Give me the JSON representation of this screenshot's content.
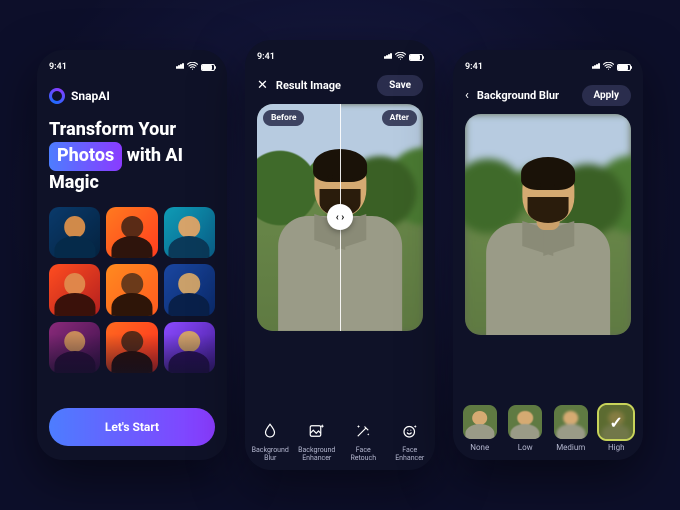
{
  "status": {
    "time": "9:41"
  },
  "screen1": {
    "brand": "SnapAI",
    "hero_line1": "Transform Your",
    "hero_highlight": "Photos",
    "hero_line2_suffix": "with AI",
    "hero_line3": "Magic",
    "cta": "Let's Start"
  },
  "screen2": {
    "title": "Result Image",
    "save": "Save",
    "before": "Before",
    "after": "After",
    "tools": [
      {
        "id": "background-blur",
        "label": "Background\nBlur"
      },
      {
        "id": "background-enhancer",
        "label": "Background\nEnhancer"
      },
      {
        "id": "face-retouch",
        "label": "Face\nRetouch"
      },
      {
        "id": "face-enhancer",
        "label": "Face\nEnhancer"
      }
    ]
  },
  "screen3": {
    "title": "Background Blur",
    "apply": "Apply",
    "presets": [
      {
        "id": "none",
        "label": "None",
        "selected": false
      },
      {
        "id": "low",
        "label": "Low",
        "selected": false
      },
      {
        "id": "medium",
        "label": "Medium",
        "selected": false
      },
      {
        "id": "high",
        "label": "High",
        "selected": true
      }
    ]
  }
}
